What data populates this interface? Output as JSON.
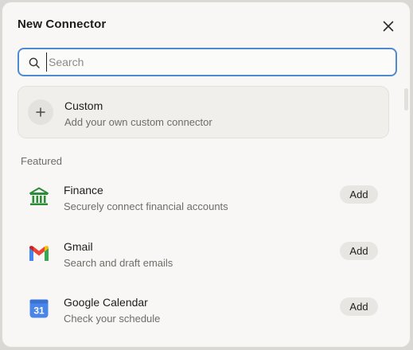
{
  "dialog": {
    "title": "New Connector",
    "close_icon": "close-icon"
  },
  "search": {
    "placeholder": "Search",
    "value": "",
    "icon": "search-icon",
    "accent": "#4f8ad1"
  },
  "custom": {
    "title": "Custom",
    "subtitle": "Add your own custom connector",
    "icon": "plus-icon"
  },
  "featured": {
    "label": "Featured",
    "items": [
      {
        "name": "Finance",
        "description": "Securely connect financial accounts",
        "icon": "bank-icon",
        "icon_color": "#2e8b3a",
        "button": "Add"
      },
      {
        "name": "Gmail",
        "description": "Search and draft emails",
        "icon": "gmail-icon",
        "button": "Add"
      },
      {
        "name": "Google Calendar",
        "description": "Check your schedule",
        "icon": "google-calendar-icon",
        "icon_text": "31",
        "icon_color": "#4a86e8",
        "button": "Add"
      }
    ]
  }
}
